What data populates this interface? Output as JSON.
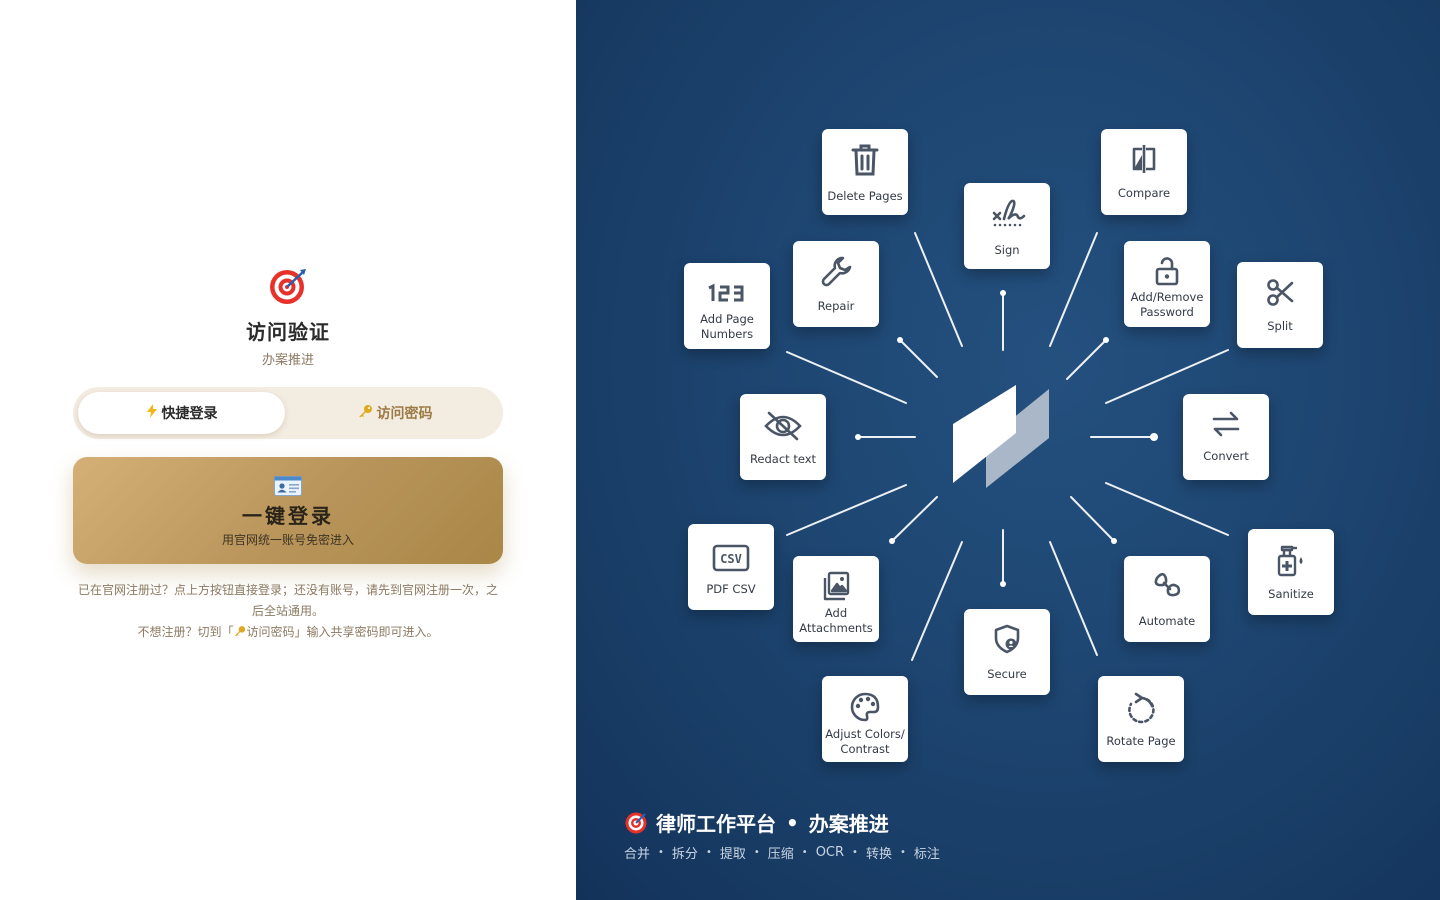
{
  "auth": {
    "title": "访问验证",
    "subtitle": "办案推进",
    "tabs": [
      {
        "label": "快捷登录",
        "icon": "lightning-icon",
        "active": true
      },
      {
        "label": "访问密码",
        "icon": "key-icon",
        "active": false
      }
    ],
    "cta": {
      "label": "一键登录",
      "sublabel": "用官网统一账号免密进入",
      "icon": "id-card-icon"
    },
    "help_line1": "已在官网注册过？点上方按钮直接登录；还没有账号，请先到官网注册一次，之",
    "help_line2": "后全站通用。",
    "help_line3_pre": "不想注册？切到「",
    "help_line3_key": "访问密码",
    "help_line3_post": "」输入共享密码即可进入。"
  },
  "tools": [
    {
      "label": "Delete Pages",
      "icon": "trash-icon"
    },
    {
      "label": "Sign",
      "icon": "signature-icon"
    },
    {
      "label": "Compare",
      "icon": "compare-icon"
    },
    {
      "label": "Repair",
      "icon": "wrench-icon"
    },
    {
      "label": "Add Page Numbers",
      "icon": "page-numbers-icon"
    },
    {
      "label": "Add/Remove Password",
      "icon": "unlock-icon"
    },
    {
      "label": "Split",
      "icon": "scissors-icon"
    },
    {
      "label": "Redact text",
      "icon": "eye-off-icon"
    },
    {
      "label": "Convert",
      "icon": "arrows-swap-icon"
    },
    {
      "label": "PDF CSV",
      "icon": "csv-icon"
    },
    {
      "label": "Add Attachments",
      "icon": "image-attachment-icon"
    },
    {
      "label": "Sanitize",
      "icon": "sanitizer-icon"
    },
    {
      "label": "Automate",
      "icon": "automate-icon"
    },
    {
      "label": "Secure",
      "icon": "shield-icon"
    },
    {
      "label": "Adjust Colors/ Contrast",
      "icon": "palette-icon"
    },
    {
      "label": "Rotate Page",
      "icon": "rotate-icon"
    }
  ],
  "footer": {
    "title_left": "律师工作平台",
    "title_sep": "•",
    "title_right": "办案推进",
    "tags": [
      "合并",
      "拆分",
      "提取",
      "压缩",
      "OCR",
      "转换",
      "标注"
    ]
  },
  "colors": {
    "accent_gold": "#b8945a",
    "panel_blue": "#1d4570",
    "tab_bg": "#f3ece1"
  }
}
